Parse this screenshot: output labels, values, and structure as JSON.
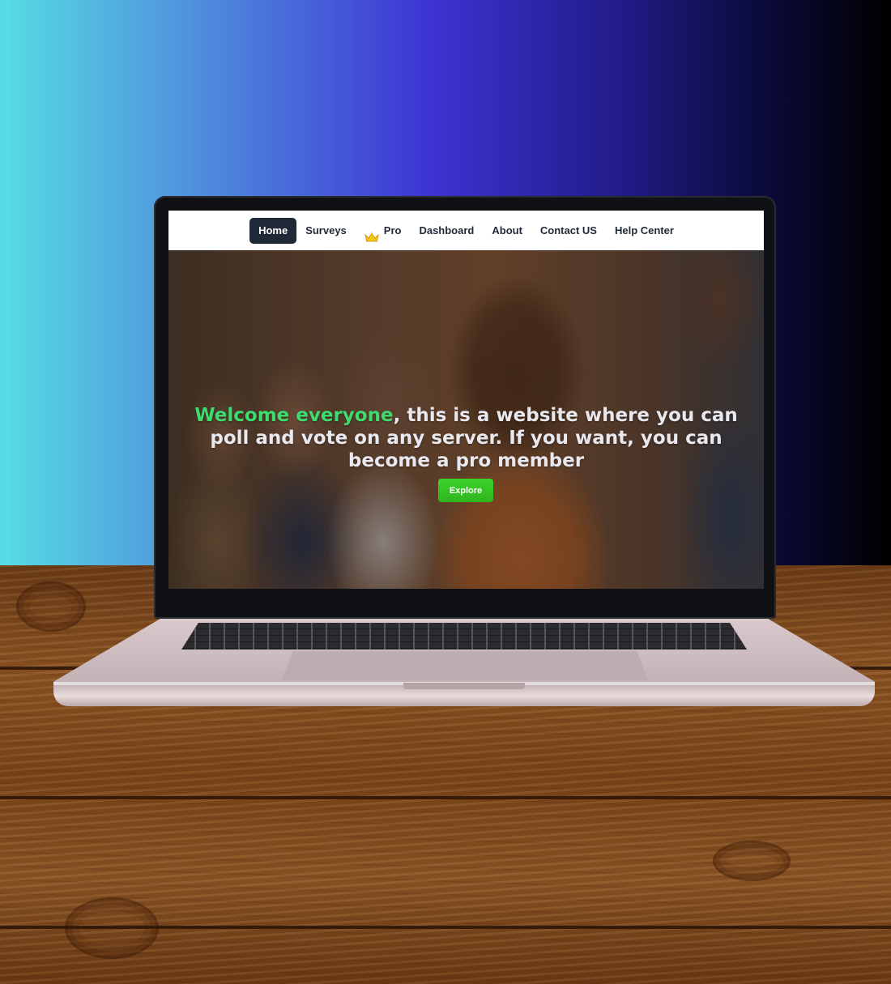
{
  "nav": {
    "items": [
      {
        "label": "Home",
        "active": true
      },
      {
        "label": "Surveys",
        "active": false
      },
      {
        "label": "Pro",
        "active": false,
        "icon": "crown-icon"
      },
      {
        "label": "Dashboard",
        "active": false
      },
      {
        "label": "About",
        "active": false
      },
      {
        "label": "Contact US",
        "active": false
      },
      {
        "label": "Help Center",
        "active": false
      }
    ]
  },
  "hero": {
    "title_accent": "Welcome everyone",
    "title_rest": ", this is a website where you can poll and vote on any server. If you want, you can become a pro member",
    "explore_label": "Explore"
  },
  "colors": {
    "accent_green": "#3ddc6e",
    "button_green": "#34c524",
    "nav_active_bg": "#1f2937",
    "nav_text": "#1f2937"
  }
}
